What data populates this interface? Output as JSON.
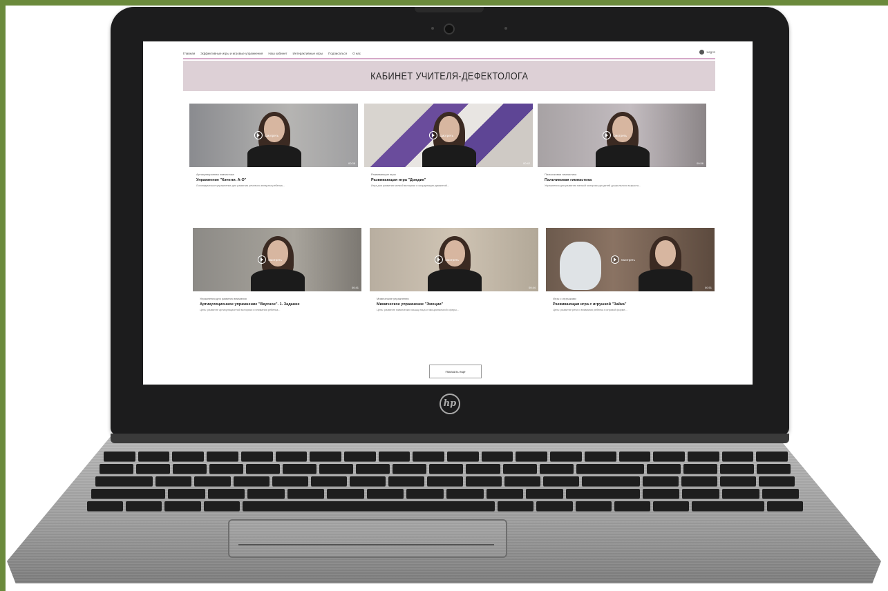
{
  "device": {
    "brand_logo": "hp"
  },
  "site": {
    "nav": {
      "items": [
        "Главная",
        "Эффективные игры и игровые упражнения",
        "Наш кабинет",
        "Интерактивные игры",
        "Подписаться",
        "О нас"
      ],
      "login_label": "Log In"
    },
    "banner_title": "КАБИНЕТ УЧИТЕЛЯ-ДЕФЕКТОЛОГА",
    "play_label": "Смотреть",
    "cards": [
      {
        "category": "Артикуляционная гимнастика",
        "title": "Упражнение \"Качели. А-О\"",
        "desc": "Логопедическое упражнение для развития речевого аппарата ребенка...",
        "duration": "00:38"
      },
      {
        "category": "Развивающие игры",
        "title": "Развивающая игра \"Дождик\"",
        "desc": "Игра для развития мелкой моторики и координации движений...",
        "duration": "00:42"
      },
      {
        "category": "Пальчиковая гимнастика",
        "title": "Пальчиковая гимнастика",
        "desc": "Упражнения для развития мелкой моторики рук детей дошкольного возраста...",
        "duration": "00:56"
      },
      {
        "category": "Упражнения для развития внимания",
        "title": "Артикуляционное упражнение \"Вкусное\". 1. Задание",
        "desc": "Цель: развитие артикуляционной моторики и внимания ребенка...",
        "duration": "00:41"
      },
      {
        "category": "Мимические упражнения",
        "title": "Мимическое упражнение \"Эмоции\"",
        "desc": "Цель: развитие мимических мышц лица и эмоциональной сферы...",
        "duration": "00:44"
      },
      {
        "category": "Игры с игрушками",
        "title": "Развивающая игра с игрушкой \"Зайка\"",
        "desc": "Цель: развитие речи и внимания ребенка в игровой форме...",
        "duration": "00:51"
      }
    ],
    "more_button": "Показать еще"
  },
  "colors": {
    "banner_bg": "#ddd0d6",
    "nav_accent": "#d6a9c8"
  }
}
